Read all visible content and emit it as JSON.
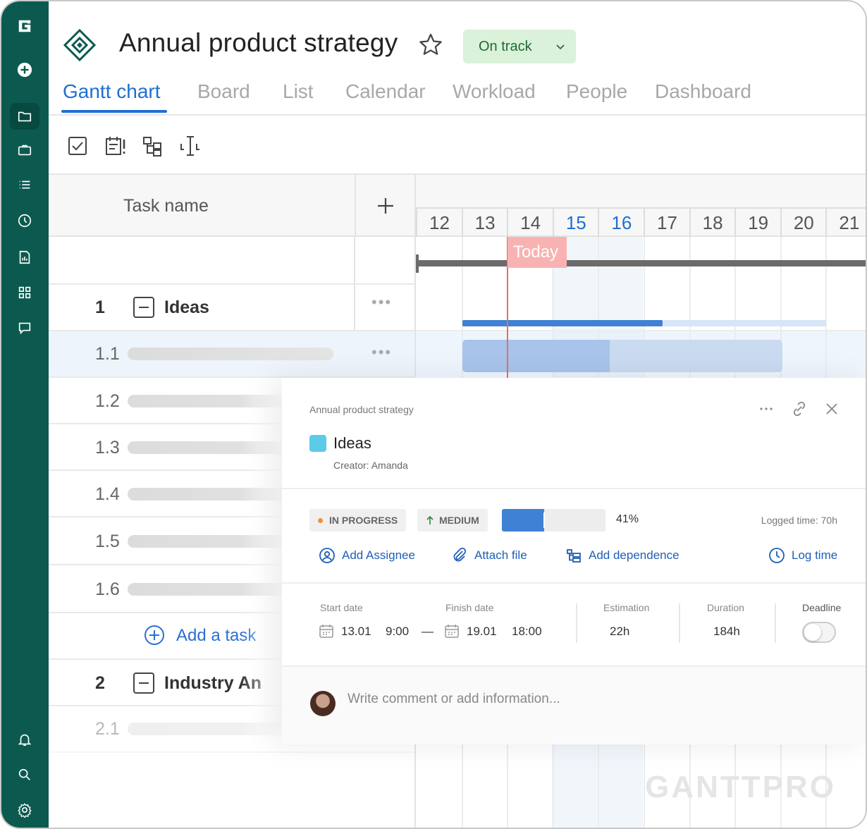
{
  "header": {
    "project_title": "Annual product strategy",
    "status_label": "On track"
  },
  "tabs": [
    "Gantt chart",
    "Board",
    "List",
    "Calendar",
    "Workload",
    "People",
    "Dashboard"
  ],
  "active_tab": "Gantt chart",
  "grid": {
    "column_task_name": "Task name",
    "add_column_symbol": "+",
    "groups": [
      {
        "number": "1",
        "title": "Ideas"
      },
      {
        "number": "2",
        "title": "Industry An"
      }
    ],
    "rows": [
      "1.1",
      "1.2",
      "1.3",
      "1.4",
      "1.5",
      "1.6"
    ],
    "row_2_1": "2.1",
    "add_task": "Add a task"
  },
  "gantt": {
    "days": [
      "12",
      "13",
      "14",
      "15",
      "16",
      "17",
      "18",
      "19",
      "20",
      "21"
    ],
    "highlighted_days": [
      "15",
      "16"
    ],
    "today_label": "Today",
    "ideas_progress": 0.55,
    "task_1_1_progress": 0.46
  },
  "panel": {
    "breadcrumb": "Annual product strategy",
    "task_title": "Ideas",
    "creator": "Creator: Amanda",
    "status_chip": "IN PROGRESS",
    "priority_chip": "MEDIUM",
    "progress_percent": 41,
    "progress_label": "41%",
    "logged_time": "Logged time: 70h",
    "actions": {
      "add_assignee": "Add Assignee",
      "attach_file": "Attach file",
      "add_dependence": "Add dependence",
      "log_time": "Log time"
    },
    "fields": {
      "start_label": "Start date",
      "start_date": "13.01",
      "start_time": "9:00",
      "dash": "—",
      "finish_label": "Finish date",
      "finish_date": "19.01",
      "finish_time": "18:00",
      "estimation_label": "Estimation",
      "estimation": "22h",
      "duration_label": "Duration",
      "duration": "184h",
      "deadline_label": "Deadline"
    },
    "comment_placeholder": "Write comment or add information..."
  },
  "brand": "GANTTPRO",
  "colors": {
    "sidebar": "#0c5a4f",
    "accent": "#1f6fd1",
    "status_bg": "#daf1da",
    "today_line": "#e86b6b",
    "task_color": "#5bcbe8"
  }
}
